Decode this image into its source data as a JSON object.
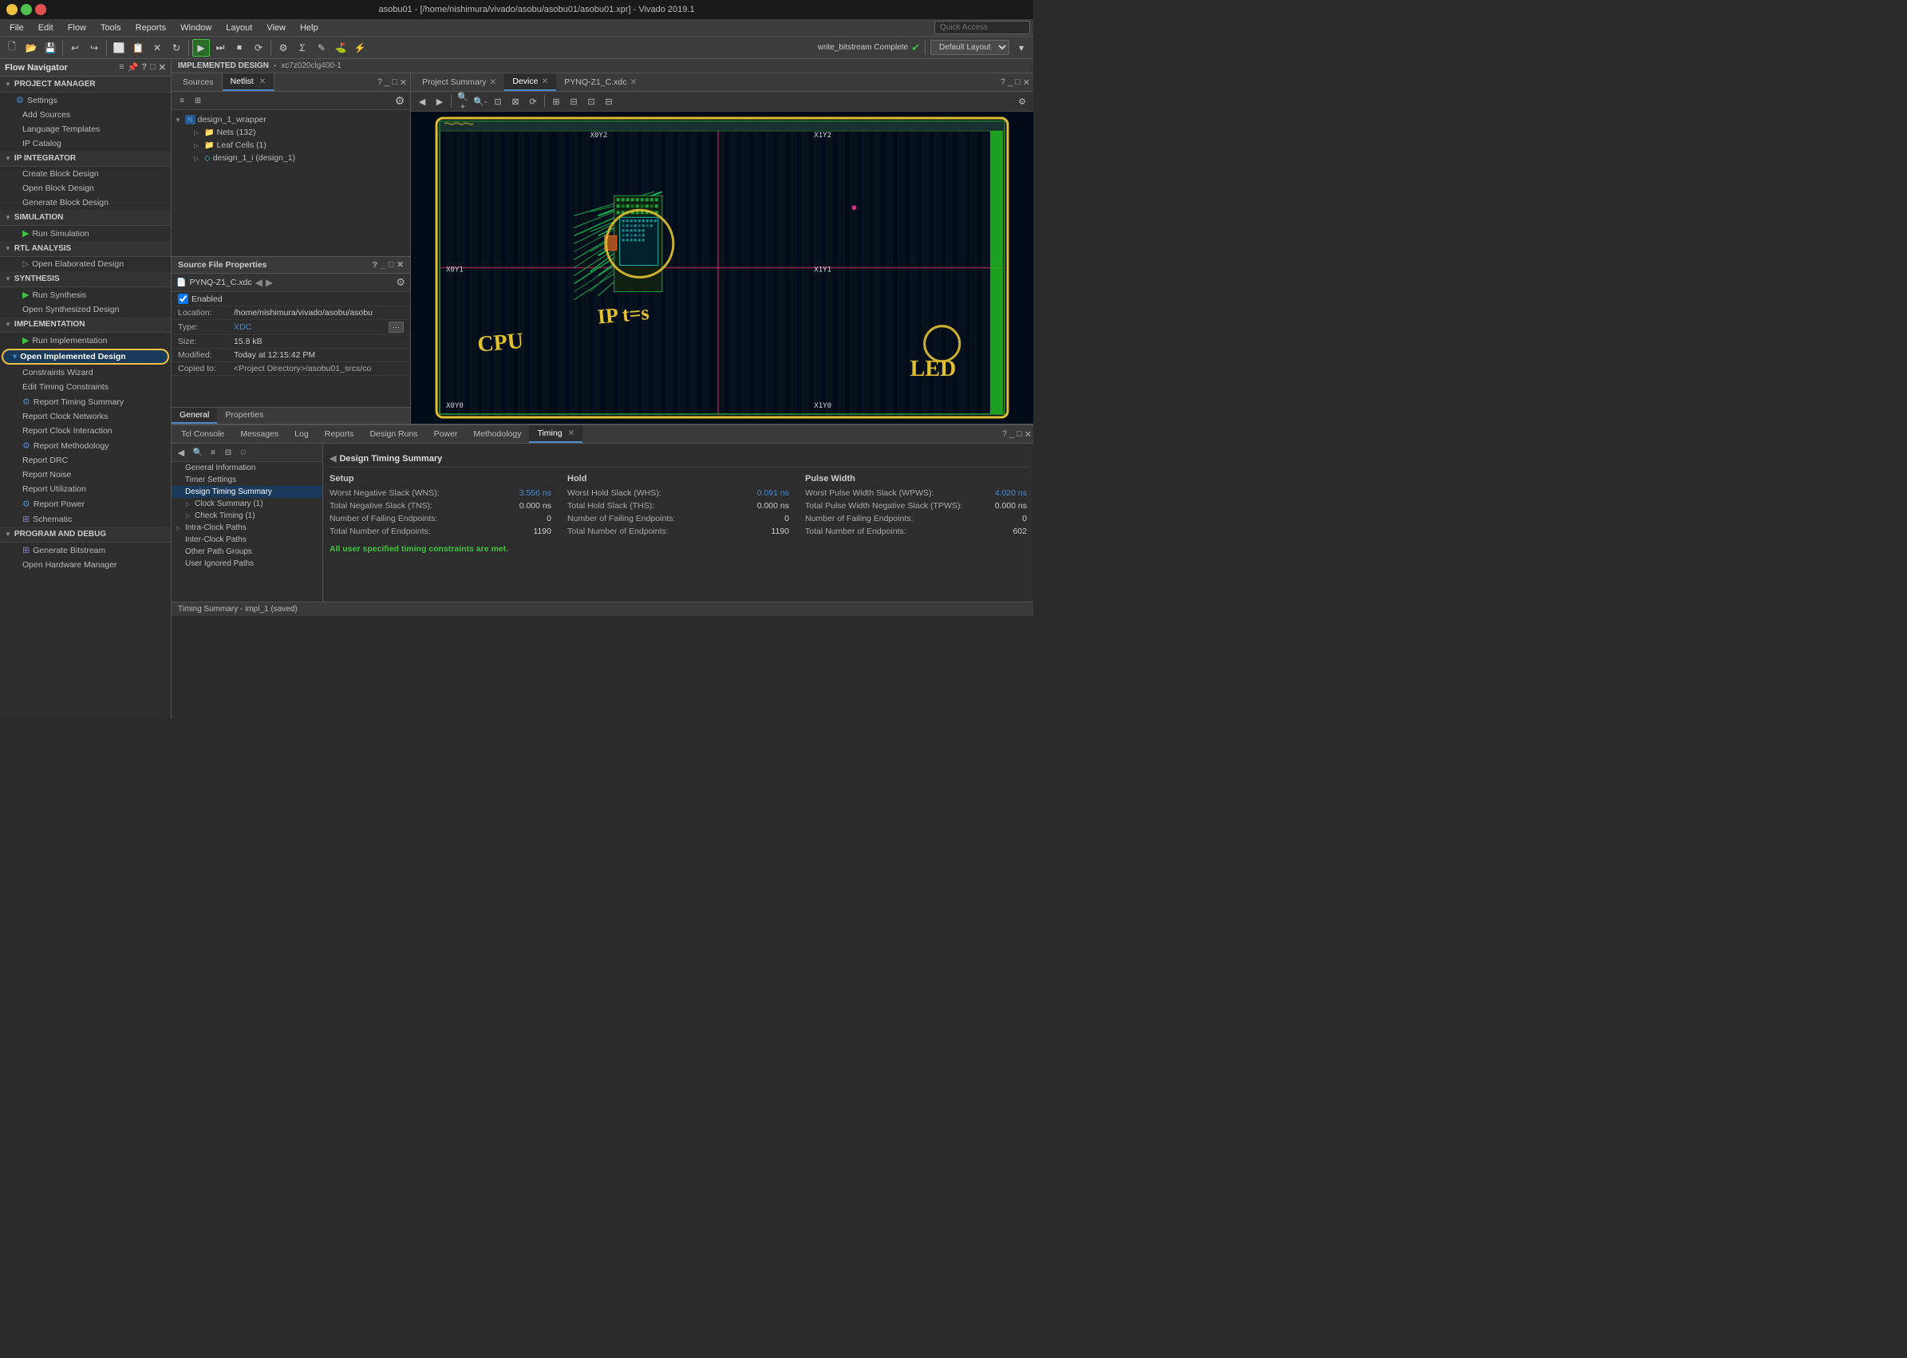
{
  "window": {
    "title": "asobu01 - [/home/nishimura/vivado/asobu/asobu01/asobu01.xpr] - Vivado 2019.1",
    "controls": [
      "minimize",
      "maximize",
      "close"
    ]
  },
  "menu": {
    "items": [
      "File",
      "Edit",
      "Flow",
      "Tools",
      "Reports",
      "Window",
      "Layout",
      "View",
      "Help"
    ],
    "search_placeholder": "Quick Access"
  },
  "toolbar": {
    "write_status": "write_bitstream Complete",
    "layout_label": "Default Layout"
  },
  "flow_navigator": {
    "title": "Flow Navigator",
    "sections": [
      {
        "name": "PROJECT MANAGER",
        "items": [
          {
            "label": "Settings",
            "icon": "gear"
          },
          {
            "label": "Add Sources",
            "icon": "none"
          },
          {
            "label": "Language Templates",
            "icon": "none"
          },
          {
            "label": "IP Catalog",
            "icon": "none"
          }
        ]
      },
      {
        "name": "IP INTEGRATOR",
        "items": [
          {
            "label": "Create Block Design",
            "icon": "none"
          },
          {
            "label": "Open Block Design",
            "icon": "none"
          },
          {
            "label": "Generate Block Design",
            "icon": "none"
          }
        ]
      },
      {
        "name": "SIMULATION",
        "items": [
          {
            "label": "Run Simulation",
            "icon": "none"
          }
        ]
      },
      {
        "name": "RTL ANALYSIS",
        "items": [
          {
            "label": "Open Elaborated Design",
            "icon": "none"
          }
        ]
      },
      {
        "name": "SYNTHESIS",
        "items": [
          {
            "label": "Run Synthesis",
            "icon": "run"
          },
          {
            "label": "Open Synthesized Design",
            "icon": "none"
          }
        ]
      },
      {
        "name": "IMPLEMENTATION",
        "items": [
          {
            "label": "Run Implementation",
            "icon": "run"
          },
          {
            "label": "Open Implemented Design",
            "icon": "none",
            "active": true,
            "highlighted": true
          },
          {
            "label": "Constraints Wizard",
            "icon": "none"
          },
          {
            "label": "Edit Timing Constraints",
            "icon": "none"
          },
          {
            "label": "Report Timing Summary",
            "icon": "gear_blue"
          },
          {
            "label": "Report Clock Networks",
            "icon": "none"
          },
          {
            "label": "Report Clock Interaction",
            "icon": "none"
          },
          {
            "label": "Report Methodology",
            "icon": "gear_blue"
          },
          {
            "label": "Report DRC",
            "icon": "none"
          },
          {
            "label": "Report Noise",
            "icon": "none"
          },
          {
            "label": "Report Utilization",
            "icon": "none"
          },
          {
            "label": "Report Power",
            "icon": "gear_blue"
          },
          {
            "label": "Schematic",
            "icon": "none"
          }
        ]
      },
      {
        "name": "PROGRAM AND DEBUG",
        "items": [
          {
            "label": "Generate Bitstream",
            "icon": "none"
          },
          {
            "label": "Open Hardware Manager",
            "icon": "none"
          }
        ]
      }
    ]
  },
  "implemented_design_bar": {
    "title": "IMPLEMENTED DESIGN",
    "part": "xc7z020clg400-1"
  },
  "sources_panel": {
    "tabs": [
      "Sources",
      "Netlist"
    ],
    "active_tab": "Netlist",
    "tree": {
      "root": "design_1_wrapper",
      "root_icon": "N",
      "children": [
        {
          "label": "Nets (132)",
          "icon": "folder",
          "indent": 1
        },
        {
          "label": "Leaf Cells (1)",
          "icon": "folder",
          "indent": 1
        },
        {
          "label": "design_1_i (design_1)",
          "icon": "leaf",
          "indent": 1
        }
      ]
    }
  },
  "source_file_properties": {
    "title": "Source File Properties",
    "filename": "PYNQ-Z1_C.xdc",
    "fields": {
      "enabled": true,
      "location": "/home/nishimura/vivado/asobu/asobu",
      "type": "XDC",
      "size": "15.8 kB",
      "modified": "Today at 12:15:42 PM",
      "copied_to": "<Project Directory>/asobu01_srcs/co"
    },
    "tabs": [
      "General",
      "Properties"
    ],
    "active_tab": "General"
  },
  "device_panel": {
    "tabs": [
      "Project Summary",
      "Device",
      "PYNQ-Z1_C.xdc"
    ],
    "active_tab": "Device",
    "coordinates": {
      "x0y0": "X0Y0",
      "x1y0": "X1Y0",
      "x0y2": "X0Y2",
      "x1y2": "X1Y2",
      "x0y1": "X0Y1",
      "x1y1": "X1Y1"
    },
    "annotations": {
      "cpu": "CPU",
      "ip_tas": "IP t=s",
      "led": "LED"
    }
  },
  "bottom_panel": {
    "tabs": [
      "Tcl Console",
      "Messages",
      "Log",
      "Reports",
      "Design Runs",
      "Power",
      "Methodology",
      "Timing"
    ],
    "active_tab": "Timing",
    "timing_tree": {
      "header": "Design Timing Summary",
      "items": [
        {
          "label": "General Information",
          "indent": 0
        },
        {
          "label": "Timer Settings",
          "indent": 0
        },
        {
          "label": "Design Timing Summary",
          "indent": 0,
          "active": true
        },
        {
          "label": "Clock Summary (1)",
          "indent": 1,
          "arrow": true
        },
        {
          "label": "Check Timing (1)",
          "indent": 1,
          "arrow": true
        },
        {
          "label": "Intra-Clock Paths",
          "indent": 0,
          "arrow": true
        },
        {
          "label": "Inter-Clock Paths",
          "indent": 0
        },
        {
          "label": "Other Path Groups",
          "indent": 0
        },
        {
          "label": "User Ignored Paths",
          "indent": 0
        }
      ]
    },
    "timing_summary": {
      "setup": {
        "title": "Setup",
        "rows": [
          {
            "label": "Worst Negative Slack (WNS):",
            "value": "3.556 ns",
            "color": "blue"
          },
          {
            "label": "Total Negative Slack (TNS):",
            "value": "0.000 ns",
            "color": "normal"
          },
          {
            "label": "Number of Failing Endpoints:",
            "value": "0",
            "color": "normal"
          },
          {
            "label": "Total Number of Endpoints:",
            "value": "1190",
            "color": "normal"
          }
        ]
      },
      "hold": {
        "title": "Hold",
        "rows": [
          {
            "label": "Worst Hold Slack (WHS):",
            "value": "0.091 ns",
            "color": "blue"
          },
          {
            "label": "Total Hold Slack (THS):",
            "value": "0.000 ns",
            "color": "normal"
          },
          {
            "label": "Number of Failing Endpoints:",
            "value": "0",
            "color": "normal"
          },
          {
            "label": "Total Number of Endpoints:",
            "value": "1190",
            "color": "normal"
          }
        ]
      },
      "pulse_width": {
        "title": "Pulse Width",
        "rows": [
          {
            "label": "Worst Pulse Width Slack (WPWS):",
            "value": "4.020 ns",
            "color": "blue"
          },
          {
            "label": "Total Pulse Width Negative Slack (TPWS):",
            "value": "0.000 ns",
            "color": "normal"
          },
          {
            "label": "Number of Failing Endpoints:",
            "value": "0",
            "color": "normal"
          },
          {
            "label": "Total Number of Endpoints:",
            "value": "602",
            "color": "normal"
          }
        ]
      },
      "constraint_message": "All user specified timing constraints are met."
    },
    "status_bar": "Timing Summary - impl_1 (saved)"
  }
}
